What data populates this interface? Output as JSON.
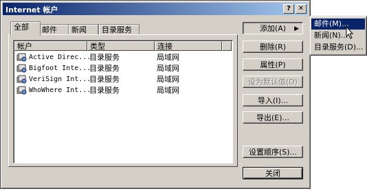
{
  "window": {
    "title": "Internet 帐户",
    "help_label": "?",
    "close_label": "✕"
  },
  "tabs": [
    {
      "label": "全部",
      "active": true
    },
    {
      "label": "邮件",
      "active": false
    },
    {
      "label": "新闻",
      "active": false
    },
    {
      "label": "目录服务",
      "active": false
    }
  ],
  "list": {
    "columns": [
      "帐户",
      "类型",
      "连接"
    ],
    "rows": [
      {
        "name": "Active Direc...",
        "type": "目录服务",
        "connection": "局域网",
        "icon": "directory-service-icon"
      },
      {
        "name": "Bigfoot Inte...",
        "type": "目录服务",
        "connection": "局域网",
        "icon": "directory-service-icon"
      },
      {
        "name": "VeriSign Int...",
        "type": "目录服务",
        "connection": "局域网",
        "icon": "directory-service-icon"
      },
      {
        "name": "WhoWhere Int...",
        "type": "目录服务",
        "connection": "局域网",
        "icon": "directory-service-icon"
      }
    ]
  },
  "buttons": {
    "add": "添加(A)",
    "delete": "删除(R)",
    "properties": "属性(P)",
    "set_default": "设为默认值(D)",
    "import": "导入(I)...",
    "export": "导出(E)...",
    "order": "设置顺序(S)...",
    "close": "关闭"
  },
  "submenu": {
    "items": [
      {
        "label": "邮件(M)...",
        "highlighted": true
      },
      {
        "label": "新闻(N)...",
        "highlighted": false
      },
      {
        "label": "目录服务(D)...",
        "highlighted": false
      }
    ]
  },
  "colors": {
    "titlebar": "#0a246a",
    "face": "#d4d0c8",
    "highlight": "#0a246a"
  }
}
